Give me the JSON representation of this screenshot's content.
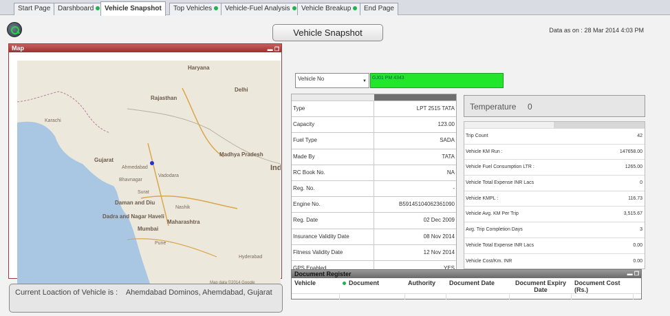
{
  "tabs": [
    {
      "label": "Start Page",
      "dot": false
    },
    {
      "label": "Darshboard",
      "dot": true
    },
    {
      "label": "Vehicle Snapshot",
      "dot": false
    },
    {
      "label": "Top Vehicles",
      "dot": true
    },
    {
      "label": "Vehicle-Fuel Analysis",
      "dot": true
    },
    {
      "label": "Vehicle Breakup",
      "dot": true
    },
    {
      "label": "End Page",
      "dot": false
    }
  ],
  "page_title": "Vehicle Snapshot",
  "data_as_on": "Data as on : 28 Mar 2014   4:03 PM",
  "map": {
    "title": "Map",
    "labels": [
      "Haryana",
      "Delhi",
      "Rajasthan",
      "Gujarat",
      "Ahmedabad",
      "Madhya Pradesh",
      "Daman and Diu",
      "Dadra and Nagar Haveli",
      "Maharashtra",
      "Mumbai",
      "Pune",
      "Hyderabad",
      "Vadodara",
      "Bhavnagar",
      "Surat",
      "Nashik",
      "Karachi",
      "Ind"
    ],
    "attribution": "Map data ©2014 Google"
  },
  "location": {
    "label": "Current Loaction of Vehicle is :",
    "value": "Ahemdabad Dominos, Ahemdabad, Gujarat"
  },
  "vehicle_select": {
    "label": "Vehicle No",
    "value": "GJ01 PM 4343"
  },
  "details": [
    {
      "label": "Type",
      "value": "LPT 2515 TATA"
    },
    {
      "label": "Capacity",
      "value": "123.00"
    },
    {
      "label": "Fuel Type",
      "value": "SADA"
    },
    {
      "label": "Made By",
      "value": "TATA"
    },
    {
      "label": "RC Book No.",
      "value": "NA"
    },
    {
      "label": "Reg. No.",
      "value": "-"
    },
    {
      "label": "Engine No.",
      "value": "B59145104062361090"
    },
    {
      "label": "Reg. Date",
      "value": "02 Dec 2009"
    },
    {
      "label": "Insurance Validity Date",
      "value": "08 Nov 2014"
    },
    {
      "label": "Fitness Validity Date",
      "value": "12 Nov 2014"
    },
    {
      "label": "GPS Enabled",
      "value": "YES"
    }
  ],
  "temperature": {
    "label": "Temperature",
    "value": "0"
  },
  "trip_stats": [
    {
      "label": "Trip Count",
      "value": "42"
    },
    {
      "label": "Vehicle KM Run :",
      "value": "147658.00"
    },
    {
      "label": "Vehicle Fuel Consumption LTR :",
      "value": "1265.00"
    },
    {
      "label": "Vehicle Total Expense INR Lacs",
      "value": "0"
    },
    {
      "label": "Vehicle KMPL :",
      "value": "116.73"
    },
    {
      "label": "Vehicle Avg. KM Per Trip",
      "value": "3,515.67"
    },
    {
      "label": "Avg. Trip Completion Days",
      "value": "3"
    },
    {
      "label": "Vehicle Total Expense INR Lacs",
      "value": "0.00"
    },
    {
      "label": "Vehicle Cost/Km. INR",
      "value": "0.00"
    }
  ],
  "document_register": {
    "title": "Document Register",
    "columns": [
      "Vehicle",
      "Document",
      "Authority",
      "Document Date",
      "Document Expiry Date",
      "Document Cost (Rs.)"
    ]
  }
}
